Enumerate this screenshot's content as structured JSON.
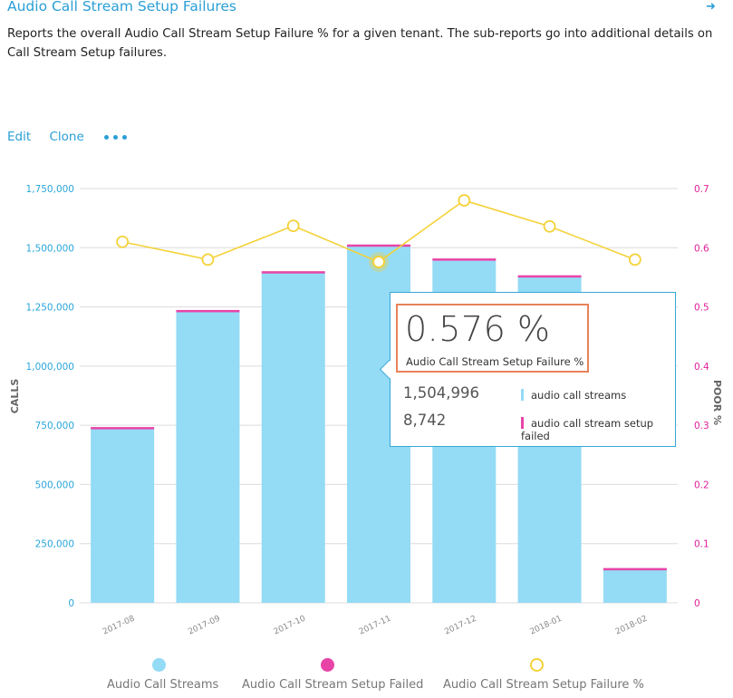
{
  "header": {
    "title": "Audio Call Stream Setup Failures",
    "arrow_glyph": "➜",
    "description": "Reports the overall Audio Call Stream Setup Failure % for a given tenant. The sub-reports go into additional details on Call Stream Setup failures."
  },
  "actions": {
    "edit": "Edit",
    "clone": "Clone",
    "more_icon": "ellipsis-icon"
  },
  "colors": {
    "streams": "#94dbf5",
    "failed": "#e844a8",
    "pct": "#f4d239",
    "left_axis": "#2aa6d9",
    "right_axis": "#e0209a"
  },
  "chart_data": {
    "type": "bar",
    "categories": [
      "2017-08",
      "2017-09",
      "2017-10",
      "2017-11",
      "2017-12",
      "2018-01",
      "2018-02"
    ],
    "series": [
      {
        "name": "Audio Call Streams",
        "type": "bar",
        "axis": "left",
        "values": [
          738000,
          1230000,
          1392000,
          1504996,
          1445000,
          1375000,
          146000
        ]
      },
      {
        "name": "Audio Call Stream Setup Failed",
        "type": "bar",
        "stacked": true,
        "axis": "left",
        "values": [
          4500,
          7100,
          8800,
          8742,
          9800,
          8700,
          850
        ]
      },
      {
        "name": "Audio Call Stream Setup Failure %",
        "type": "line",
        "axis": "right",
        "values": [
          0.61,
          0.58,
          0.637,
          0.576,
          0.68,
          0.636,
          0.58
        ]
      }
    ],
    "left_axis": {
      "label": "CALLS",
      "ylim": [
        0,
        1750000
      ],
      "ticks": [
        "0",
        "250,000",
        "500,000",
        "750,000",
        "1,000,000",
        "1,250,000",
        "1,500,000",
        "1,750,000"
      ]
    },
    "right_axis": {
      "label": "POOR %",
      "ylim": [
        0,
        0.7
      ],
      "ticks": [
        "0",
        "0.1",
        "0.2",
        "0.3",
        "0.4",
        "0.5",
        "0.6",
        "0.7"
      ]
    },
    "highlight_index": 3,
    "grid": true,
    "legend": {
      "position": "bottom",
      "labels": [
        "Audio Call Streams",
        "Audio Call Stream Setup Failed",
        "Audio Call Stream Setup Failure %"
      ]
    }
  },
  "tooltip": {
    "big_value": "0.576 %",
    "big_label": "Audio Call Stream Setup Failure %",
    "rows": [
      {
        "value": "1,504,996",
        "label": "audio call streams"
      },
      {
        "value": "8,742",
        "label": "audio call stream setup failed"
      }
    ]
  }
}
